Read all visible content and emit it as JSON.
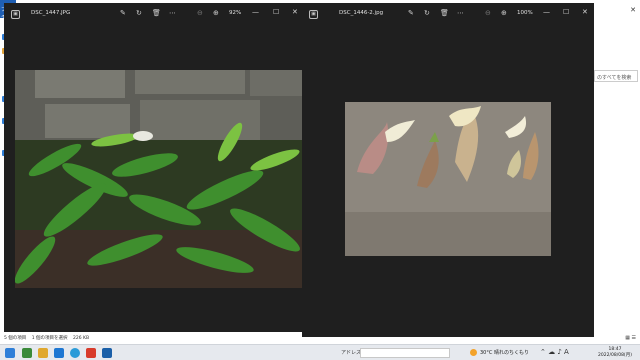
{
  "viewer_left": {
    "filename": "DSC_1447.JPG",
    "zoom": "92%"
  },
  "viewer_right": {
    "filename": "DSC_1446-2.jpg",
    "zoom": "100%"
  },
  "explorer": {
    "tab_label": "ファイ",
    "search_placeholder": "のすべてを検索",
    "status_items": [
      "5 個の項目",
      "1 個の項目を選択",
      "226 KB"
    ]
  },
  "taskbar": {
    "search_label": "アドレス",
    "weather": "30°C 晴れのちくもり",
    "clock_time": "18:47",
    "clock_date": "2022/08/08(月)"
  }
}
